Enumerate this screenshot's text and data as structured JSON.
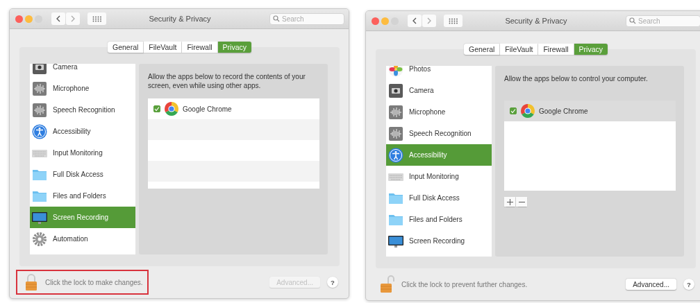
{
  "windows": [
    {
      "title": "Security & Privacy",
      "search": {
        "placeholder": "Search"
      },
      "tabs": [
        {
          "label": "General",
          "selected": false
        },
        {
          "label": "FileVault",
          "selected": false
        },
        {
          "label": "Firewall",
          "selected": false
        },
        {
          "label": "Privacy",
          "selected": true
        }
      ],
      "categories": [
        {
          "label": "Camera",
          "kind": "camera",
          "selected": false
        },
        {
          "label": "Microphone",
          "kind": "microphone",
          "selected": false
        },
        {
          "label": "Speech Recognition",
          "kind": "speech",
          "selected": false
        },
        {
          "label": "Accessibility",
          "kind": "accessibility",
          "selected": false
        },
        {
          "label": "Input Monitoring",
          "kind": "keyboard",
          "selected": false
        },
        {
          "label": "Full Disk Access",
          "kind": "folder",
          "selected": false
        },
        {
          "label": "Files and Folders",
          "kind": "folder",
          "selected": false
        },
        {
          "label": "Screen Recording",
          "kind": "display",
          "selected": true
        },
        {
          "label": "Automation",
          "kind": "gear",
          "selected": false
        }
      ],
      "description": "Allow the apps below to record the contents of your screen, even while using other apps.",
      "apps": [
        {
          "name": "Google Chrome",
          "checked": true,
          "selected": false
        }
      ],
      "striped": true,
      "add_remove": false,
      "lock": {
        "locked": true,
        "text": "Click the lock to make changes.",
        "highlighted": true
      },
      "advanced": {
        "label": "Advanced...",
        "disabled": true
      },
      "help": "?"
    },
    {
      "title": "Security & Privacy",
      "search": {
        "placeholder": "Search"
      },
      "tabs": [
        {
          "label": "General",
          "selected": false
        },
        {
          "label": "FileVault",
          "selected": false
        },
        {
          "label": "Firewall",
          "selected": false
        },
        {
          "label": "Privacy",
          "selected": true
        }
      ],
      "categories": [
        {
          "label": "Photos",
          "kind": "photos",
          "selected": false
        },
        {
          "label": "Camera",
          "kind": "camera",
          "selected": false
        },
        {
          "label": "Microphone",
          "kind": "microphone",
          "selected": false
        },
        {
          "label": "Speech Recognition",
          "kind": "speech",
          "selected": false
        },
        {
          "label": "Accessibility",
          "kind": "accessibility",
          "selected": true
        },
        {
          "label": "Input Monitoring",
          "kind": "keyboard",
          "selected": false
        },
        {
          "label": "Full Disk Access",
          "kind": "folder",
          "selected": false
        },
        {
          "label": "Files and Folders",
          "kind": "folder",
          "selected": false
        },
        {
          "label": "Screen Recording",
          "kind": "display",
          "selected": false
        }
      ],
      "description": "Allow the apps below to control your computer.",
      "apps": [
        {
          "name": "Google Chrome",
          "checked": true,
          "selected": true
        }
      ],
      "striped": false,
      "add_remove": true,
      "lock": {
        "locked": false,
        "text": "Click the lock to prevent further changes.",
        "highlighted": false
      },
      "advanced": {
        "label": "Advanced...",
        "disabled": false
      },
      "help": "?"
    }
  ]
}
